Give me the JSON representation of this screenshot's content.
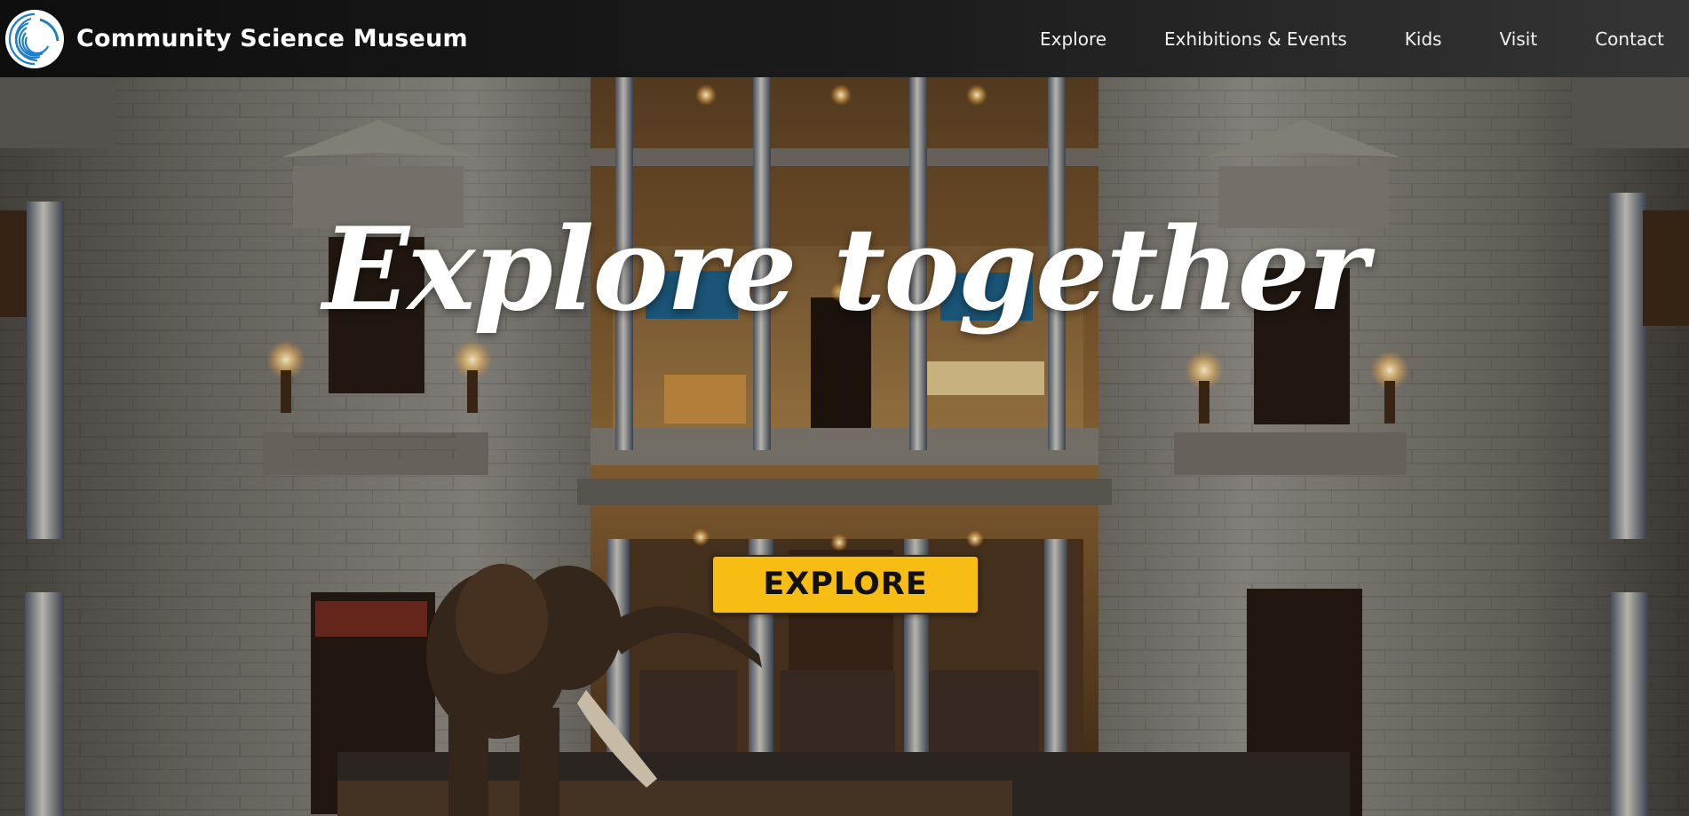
{
  "header": {
    "site_title": "Community Science Museum",
    "logo_icon": "spiral-logo-icon",
    "nav": [
      {
        "label": "Explore"
      },
      {
        "label": "Exhibitions & Events"
      },
      {
        "label": "Kids"
      },
      {
        "label": "Visit"
      },
      {
        "label": "Contact"
      }
    ]
  },
  "hero": {
    "heading": "Explore together",
    "cta_label": "EXPLORE",
    "background": "museum-rotunda-photo"
  },
  "colors": {
    "header_bg": "#151515",
    "cta_bg": "#f7bd12",
    "cta_text": "#111111",
    "logo_blue": "#1f7fc6"
  }
}
